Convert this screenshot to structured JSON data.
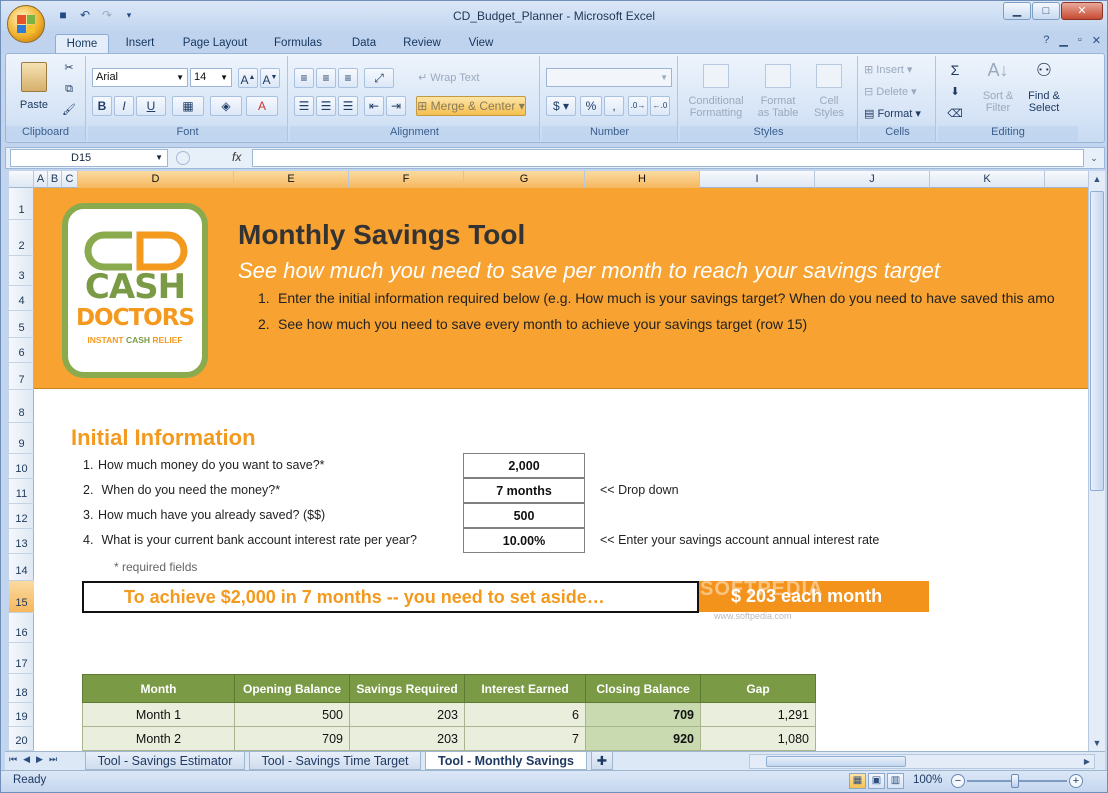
{
  "window": {
    "title": "CD_Budget_Planner - Microsoft Excel"
  },
  "qat": {
    "icons": [
      "save-icon",
      "undo-icon",
      "redo-icon"
    ]
  },
  "ribbon_tabs": [
    "Home",
    "Insert",
    "Page Layout",
    "Formulas",
    "Data",
    "Review",
    "View"
  ],
  "ribbon": {
    "clipboard": {
      "label": "Clipboard",
      "paste": "Paste"
    },
    "font": {
      "label": "Font",
      "family": "Arial",
      "size": "14",
      "bold": "B",
      "italic": "I",
      "underline": "U"
    },
    "alignment": {
      "label": "Alignment",
      "wrap": "Wrap Text",
      "merge": "Merge & Center"
    },
    "number": {
      "label": "Number",
      "format": "",
      "currency": "$",
      "percent": "%",
      "comma": ","
    },
    "styles": {
      "label": "Styles",
      "conditional": "Conditional",
      "conditional2": "Formatting",
      "format_table": "Format",
      "format_table2": "as Table",
      "cell_styles": "Cell",
      "cell_styles2": "Styles"
    },
    "cells": {
      "label": "Cells",
      "insert": "Insert",
      "delete": "Delete",
      "format": "Format"
    },
    "editing": {
      "label": "Editing",
      "sort": "Sort &",
      "sort2": "Filter",
      "find": "Find &",
      "find2": "Select"
    }
  },
  "formula_bar": {
    "name_box": "D15",
    "fx": "fx",
    "content": ""
  },
  "columns": [
    "A",
    "B",
    "C",
    "D",
    "E",
    "F",
    "G",
    "H",
    "I",
    "J",
    "K"
  ],
  "rows": [
    "1",
    "2",
    "3",
    "4",
    "5",
    "6",
    "7",
    "8",
    "9",
    "10",
    "11",
    "12",
    "13",
    "14",
    "15",
    "16",
    "17",
    "18",
    "19",
    "20"
  ],
  "banner": {
    "title": "Monthly Savings Tool",
    "subtitle": "See how much you need to save per month to reach your savings target",
    "steps": [
      {
        "num": "1.",
        "text": "Enter the initial information required below (e.g. How much is your savings target? When do you need to have saved this amo"
      },
      {
        "num": "2.",
        "text": "See how much you need to save every month to achieve your savings target (row 15)"
      }
    ]
  },
  "logo": {
    "line1": "CASH",
    "line2": "DOCTORS",
    "tag1": "INSTANT ",
    "tag2": "CASH",
    "tag3": " RELIEF"
  },
  "section": {
    "title": "Initial Information"
  },
  "questions": [
    {
      "num": "1.",
      "text": "How much money do you want to save?*",
      "value": "2,000",
      "note": ""
    },
    {
      "num": "2.",
      "text": " When do you need the money?*",
      "value": "7 months",
      "note": "<< Drop down"
    },
    {
      "num": "3.",
      "text": "How much have you already saved? ($$)",
      "value": "500",
      "note": ""
    },
    {
      "num": "4.",
      "text": " What is your current bank account interest rate per year?",
      "value": "10.00%",
      "note": "<< Enter your savings account annual interest rate"
    }
  ],
  "required_note": "* required fields",
  "achieve_text": "To achieve  $2,000  in 7 months  --  you need to set aside…",
  "result_text": "$ 203  each month",
  "watermark": "SOFTPEDIA",
  "watermark2": "www.softpedia.com",
  "table": {
    "headers": [
      "Month",
      "Opening Balance",
      "Savings Required",
      "Interest Earned",
      "Closing Balance",
      "Gap"
    ],
    "rows": [
      [
        "Month 1",
        "500",
        "203",
        "6",
        "709",
        "1,291"
      ],
      [
        "Month 2",
        "709",
        "203",
        "7",
        "920",
        "1,080"
      ]
    ]
  },
  "sheet_tabs": [
    "Tool - Savings Estimator",
    "Tool - Savings Time Target",
    "Tool - Monthly Savings"
  ],
  "status": {
    "mode": "Ready",
    "zoom": "100%"
  },
  "colors": {
    "banner": "#f7a231",
    "accent_orange": "#f39a1e",
    "table_header": "#7a9a45"
  }
}
